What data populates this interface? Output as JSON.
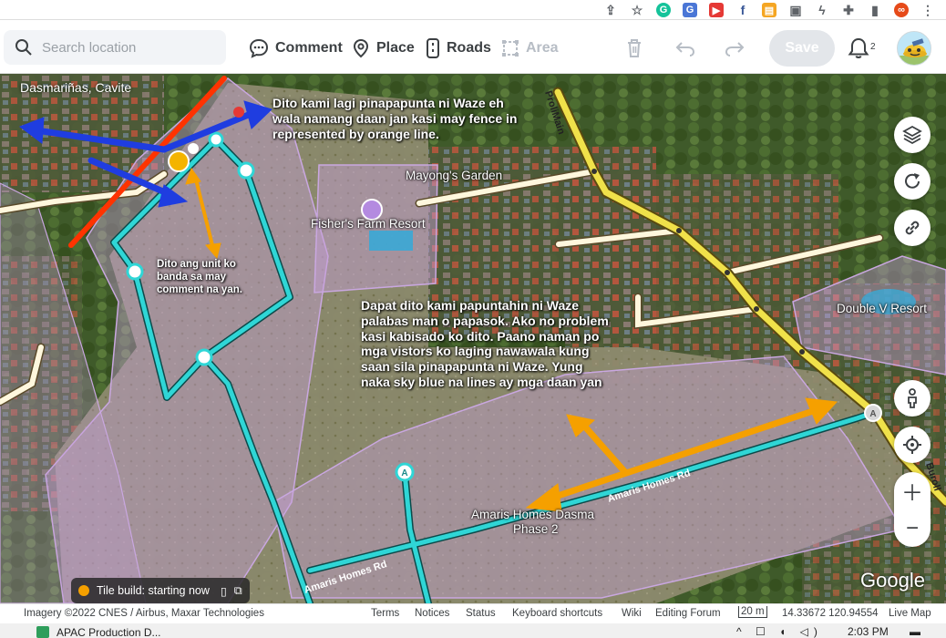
{
  "search": {
    "placeholder": "Search location"
  },
  "toolbar": {
    "comment_label": "Comment",
    "place_label": "Place",
    "roads_label": "Roads",
    "area_label": "Area",
    "save_label": "Save",
    "notification_count": "2"
  },
  "map": {
    "city": "Dasmariñas, Cavite",
    "street_label": "ProliMain",
    "street_label_2": "Buroll",
    "places": {
      "mayongs_garden": "Mayong's Garden",
      "fishers_farm": "Fisher's Farm Resort",
      "double_v": "Double V Resort",
      "amaris": "Amaris Homes Dasma",
      "amaris_phase": "Phase 2"
    },
    "road_names": {
      "road_a": "Amaris Homes Rd",
      "road_b": "Amaris Homes Rd"
    },
    "node_markers": {
      "a1": "A",
      "a2": "A"
    },
    "annotations": {
      "top": "Dito kami lagi pinapapunta ni Waze eh wala namang daan jan kasi may fence in represented by orange line.",
      "unit": "Dito ang unit ko banda sa may comment na yan.",
      "middle": "Dapat dito kami papuntahin ni Waze palabas man o papasok. Ako no problem kasi kabisado ko dito. Paano naman po mga vistors ko laging nawawala kung saan sila pinapapunta ni Waze. Yung naka sky blue na lines ay mga daan yan"
    },
    "tile_build": "Tile build: starting now",
    "google": "Google"
  },
  "footer": {
    "imagery": "Imagery ©2022 CNES / Airbus, Maxar Technologies",
    "terms": "Terms",
    "notices": "Notices",
    "status": "Status",
    "shortcuts": "Keyboard shortcuts",
    "wiki": "Wiki",
    "forum": "Editing Forum",
    "scale": "20 m",
    "coords": "14.33672 120.94554",
    "live_map": "Live Map"
  },
  "taskbar": {
    "app": "APAC Production D...",
    "time": "2:03 PM"
  },
  "colors": {
    "primary_road": "#f0e14a",
    "street": "#fff7dd",
    "private_road": "#2fd6d6",
    "area_fill": "rgba(200,160,220,0.45)",
    "annotation_blue": "#1f3de0",
    "annotation_orange": "#f5a000",
    "annotation_red": "#ff3300"
  }
}
